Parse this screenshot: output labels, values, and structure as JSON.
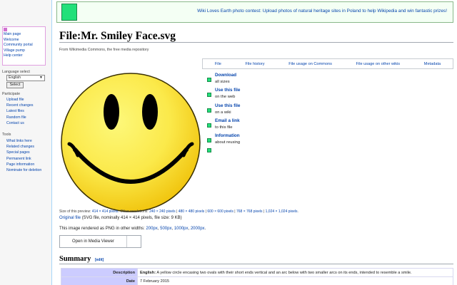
{
  "sidebar": {
    "nav": [
      "Main page",
      "Welcome",
      "Community portal",
      "Village pump",
      "Help center"
    ],
    "language_label": "Language select",
    "language_value": "English",
    "select_button": "Select",
    "participate_label": "Participate",
    "participate": [
      "Upload file",
      "Recent changes",
      "Latest files",
      "Random file",
      "Contact us"
    ],
    "tools_label": "Tools",
    "tools": [
      "What links here",
      "Related changes",
      "Special pages",
      "Permanent link",
      "Page information",
      "Nominate for deletion"
    ]
  },
  "banner": {
    "text": "Wiki Loves Earth photo contest: Upload photos of natural heritage sites in Poland to help Wikipedia and win fantastic prizes!",
    "logo_color": "#22e07a"
  },
  "page": {
    "title": "File:Mr. Smiley Face.svg",
    "site_sub": "From Wikimedia Commons, the free media repository"
  },
  "tabs": [
    "File",
    "File history",
    "File usage on Commons",
    "File usage on other wikis",
    "Metadata"
  ],
  "side_links": [
    {
      "title": "Download",
      "sub": "all sizes"
    },
    {
      "title": "Use this file",
      "sub": "on the web"
    },
    {
      "title": "Use this file",
      "sub": "on a wiki"
    },
    {
      "title": "Email a link",
      "sub": "to this file"
    },
    {
      "title": "Information",
      "sub": "about reusing"
    }
  ],
  "preview": {
    "prefix": "Size of this preview:",
    "size": "414 × 414 pixels",
    "other_label": "Other resolutions:",
    "others": [
      "240 × 240 pixels",
      "480 × 480 pixels",
      "600 × 600 pixels",
      "768 × 768 pixels",
      "1,024 × 1,024 pixels"
    ]
  },
  "original": {
    "link": "Original file",
    "info": "(SVG file, nominally 414 × 414 pixels, file size: 9 KB)"
  },
  "png": {
    "prefix": "This image rendered as PNG in other widths:",
    "widths": [
      "200px",
      "500px",
      "1000px",
      "2000px"
    ]
  },
  "viewer_button": "Open in Media Viewer",
  "summary": {
    "title": "Summary",
    "edit": "[edit]",
    "rows": [
      {
        "key": "Description",
        "lang": "English:",
        "value": "A yellow circle encasing two ovals with their short ends vertical and an arc below with two smaller arcs on its ends, intended to resemble a smile."
      },
      {
        "key": "Date",
        "lang": "",
        "value": "7 February 2015"
      }
    ]
  },
  "colors": {
    "link": "#0645ad",
    "smiley_light": "#fdf87a",
    "smiley_dark": "#f0c20a",
    "table_key_bg": "#ccccff"
  }
}
